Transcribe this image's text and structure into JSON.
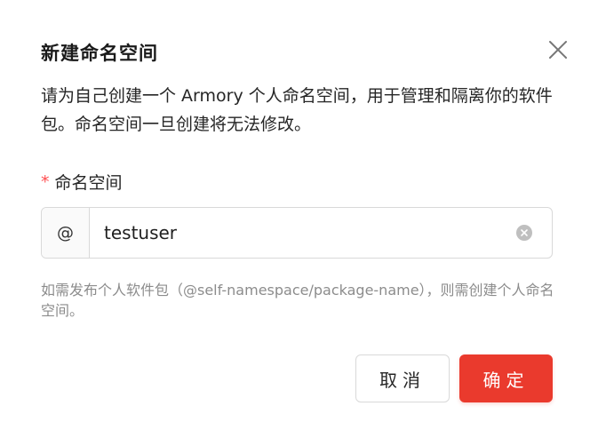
{
  "dialog": {
    "title": "新建命名空间",
    "description": "请为自己创建一个 Armory 个人命名空间，用于管理和隔离你的软件包。命名空间一旦创建将无法修改。",
    "field": {
      "required_mark": "*",
      "label": "命名空间",
      "prefix": "@",
      "value": "testuser"
    },
    "help_text": "如需发布个人软件包（@self-namespace/package-name），则需创建个人命名空间。",
    "buttons": {
      "cancel": "取消",
      "ok": "确定"
    }
  },
  "colors": {
    "primary": "#ea3a2d",
    "required": "#ff4d4f",
    "help_text": "#8c8c8c"
  },
  "icons": {
    "close": "close-icon",
    "clear": "clear-circle-icon"
  }
}
